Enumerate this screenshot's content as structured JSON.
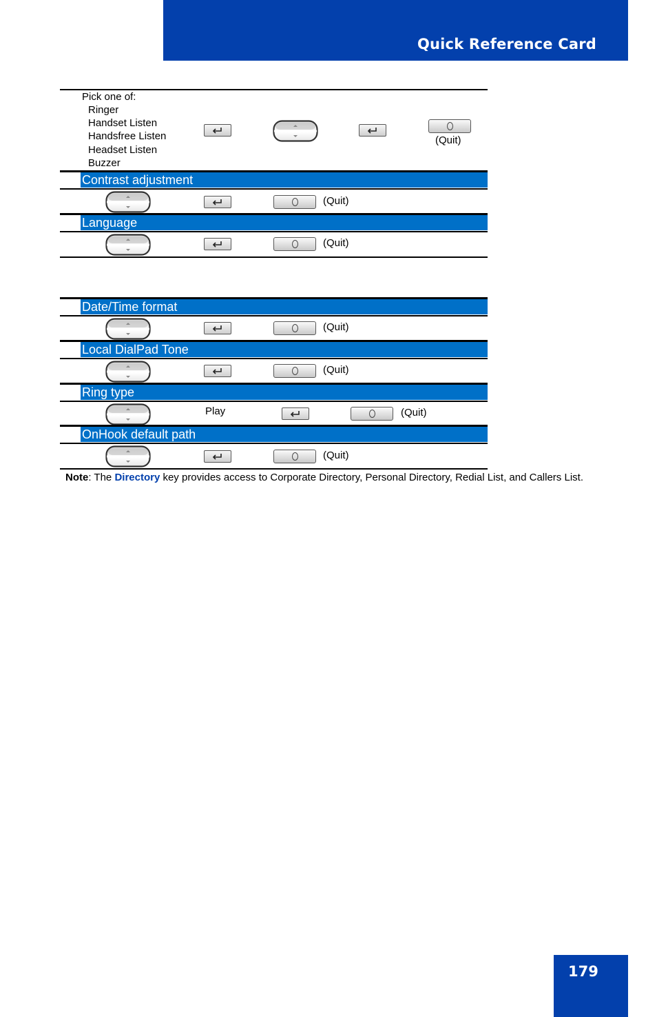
{
  "header": {
    "title": "Quick Reference Card"
  },
  "page_number": "179",
  "first_block": {
    "intro": "Pick one of:",
    "options": [
      "Ringer",
      "Handset Listen",
      "Handsfree Listen",
      "Headset Listen",
      "Buzzer"
    ],
    "steps": [
      "enter-key-icon",
      "navigation-key-icon",
      "enter-key-icon",
      "quit-key-icon"
    ],
    "quit_label": "(Quit)"
  },
  "sections": [
    {
      "title": "Contrast adjustment",
      "steps": [
        "navigation-key-icon",
        "enter-key-icon",
        "quit-key-icon"
      ],
      "quit_label": "(Quit)"
    },
    {
      "title": "Language",
      "steps": [
        "navigation-key-icon",
        "enter-key-icon",
        "quit-key-icon"
      ],
      "quit_label": "(Quit)"
    },
    {
      "title": "Date/Time format",
      "steps": [
        "navigation-key-icon",
        "enter-key-icon",
        "quit-key-icon"
      ],
      "quit_label": "(Quit)"
    },
    {
      "title": "Local DialPad Tone",
      "steps": [
        "navigation-key-icon",
        "enter-key-icon",
        "quit-key-icon"
      ],
      "quit_label": "(Quit)"
    },
    {
      "title": "Ring type",
      "steps": [
        "navigation-key-icon",
        "Play",
        "enter-key-icon",
        "quit-key-icon"
      ],
      "play_label": "Play",
      "quit_label": "(Quit)"
    },
    {
      "title": "OnHook default path",
      "steps": [
        "navigation-key-icon",
        "enter-key-icon",
        "quit-key-icon"
      ],
      "quit_label": "(Quit)"
    }
  ],
  "note": {
    "label": "Note",
    "prefix": ": The ",
    "keyword": "Directory",
    "text": " key provides access to Corporate Directory, Personal Directory, Redial List, and Callers List."
  },
  "colors": {
    "brand_blue": "#0340ac",
    "section_bar": "#0070c8"
  }
}
